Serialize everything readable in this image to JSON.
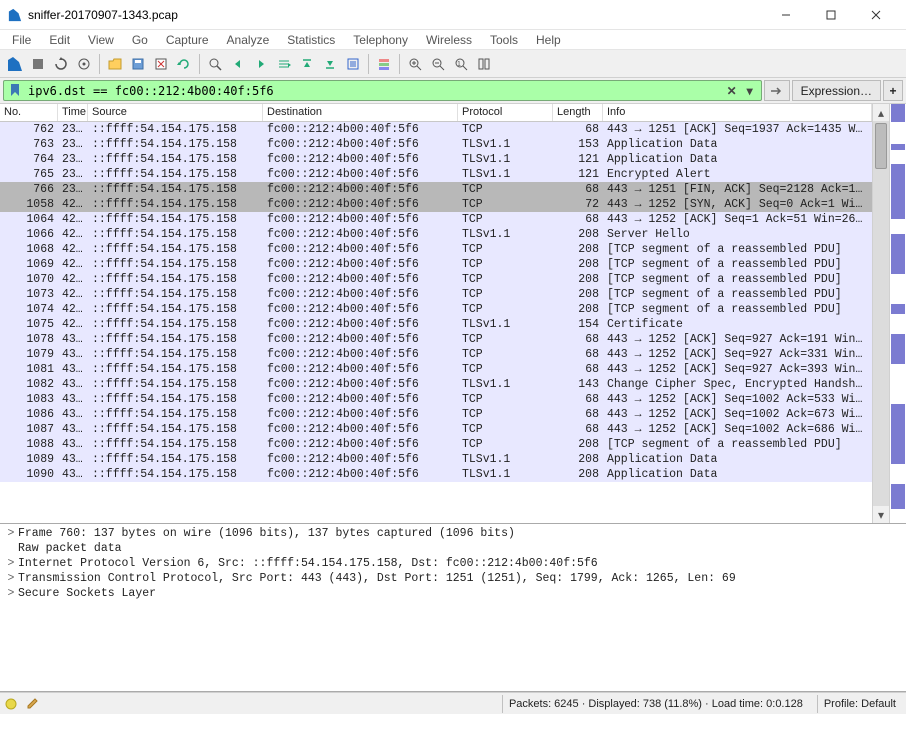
{
  "window": {
    "title": "sniffer-20170907-1343.pcap"
  },
  "menus": [
    "File",
    "Edit",
    "View",
    "Go",
    "Capture",
    "Analyze",
    "Statistics",
    "Telephony",
    "Wireless",
    "Tools",
    "Help"
  ],
  "filter": {
    "value": "ipv6.dst == fc00::212:4b00:40f:5f6",
    "expr_label": "Expression…"
  },
  "columns": {
    "no": "No.",
    "time": "Time",
    "src": "Source",
    "dst": "Destination",
    "proto": "Protocol",
    "len": "Length",
    "info": "Info"
  },
  "packets": [
    {
      "no": "762",
      "time": "23…",
      "src": "::ffff:54.154.175.158",
      "dst": "fc00::212:4b00:40f:5f6",
      "proto": "TCP",
      "len": "68",
      "info": "443 → 1251 [ACK] Seq=1937 Ack=1435 Wi…",
      "sel": false
    },
    {
      "no": "763",
      "time": "23…",
      "src": "::ffff:54.154.175.158",
      "dst": "fc00::212:4b00:40f:5f6",
      "proto": "TLSv1.1",
      "len": "153",
      "info": "Application Data",
      "sel": false
    },
    {
      "no": "764",
      "time": "23…",
      "src": "::ffff:54.154.175.158",
      "dst": "fc00::212:4b00:40f:5f6",
      "proto": "TLSv1.1",
      "len": "121",
      "info": "Application Data",
      "sel": false
    },
    {
      "no": "765",
      "time": "23…",
      "src": "::ffff:54.154.175.158",
      "dst": "fc00::212:4b00:40f:5f6",
      "proto": "TLSv1.1",
      "len": "121",
      "info": "Encrypted Alert",
      "sel": false
    },
    {
      "no": "766",
      "time": "23…",
      "src": "::ffff:54.154.175.158",
      "dst": "fc00::212:4b00:40f:5f6",
      "proto": "TCP",
      "len": "68",
      "info": "443 → 1251 [FIN, ACK] Seq=2128 Ack=14…",
      "sel": true
    },
    {
      "no": "1058",
      "time": "42…",
      "src": "::ffff:54.154.175.158",
      "dst": "fc00::212:4b00:40f:5f6",
      "proto": "TCP",
      "len": "72",
      "info": "443 → 1252 [SYN, ACK] Seq=0 Ack=1 Win…",
      "sel": true
    },
    {
      "no": "1064",
      "time": "42…",
      "src": "::ffff:54.154.175.158",
      "dst": "fc00::212:4b00:40f:5f6",
      "proto": "TCP",
      "len": "68",
      "info": "443 → 1252 [ACK] Seq=1 Ack=51 Win=268…",
      "sel": false
    },
    {
      "no": "1066",
      "time": "42…",
      "src": "::ffff:54.154.175.158",
      "dst": "fc00::212:4b00:40f:5f6",
      "proto": "TLSv1.1",
      "len": "208",
      "info": "Server Hello",
      "sel": false
    },
    {
      "no": "1068",
      "time": "42…",
      "src": "::ffff:54.154.175.158",
      "dst": "fc00::212:4b00:40f:5f6",
      "proto": "TCP",
      "len": "208",
      "info": "[TCP segment of a reassembled PDU]",
      "sel": false
    },
    {
      "no": "1069",
      "time": "42…",
      "src": "::ffff:54.154.175.158",
      "dst": "fc00::212:4b00:40f:5f6",
      "proto": "TCP",
      "len": "208",
      "info": "[TCP segment of a reassembled PDU]",
      "sel": false
    },
    {
      "no": "1070",
      "time": "42…",
      "src": "::ffff:54.154.175.158",
      "dst": "fc00::212:4b00:40f:5f6",
      "proto": "TCP",
      "len": "208",
      "info": "[TCP segment of a reassembled PDU]",
      "sel": false
    },
    {
      "no": "1073",
      "time": "42…",
      "src": "::ffff:54.154.175.158",
      "dst": "fc00::212:4b00:40f:5f6",
      "proto": "TCP",
      "len": "208",
      "info": "[TCP segment of a reassembled PDU]",
      "sel": false
    },
    {
      "no": "1074",
      "time": "42…",
      "src": "::ffff:54.154.175.158",
      "dst": "fc00::212:4b00:40f:5f6",
      "proto": "TCP",
      "len": "208",
      "info": "[TCP segment of a reassembled PDU]",
      "sel": false
    },
    {
      "no": "1075",
      "time": "42…",
      "src": "::ffff:54.154.175.158",
      "dst": "fc00::212:4b00:40f:5f6",
      "proto": "TLSv1.1",
      "len": "154",
      "info": "Certificate",
      "sel": false
    },
    {
      "no": "1078",
      "time": "43…",
      "src": "::ffff:54.154.175.158",
      "dst": "fc00::212:4b00:40f:5f6",
      "proto": "TCP",
      "len": "68",
      "info": "443 → 1252 [ACK] Seq=927 Ack=191 Win=…",
      "sel": false
    },
    {
      "no": "1079",
      "time": "43…",
      "src": "::ffff:54.154.175.158",
      "dst": "fc00::212:4b00:40f:5f6",
      "proto": "TCP",
      "len": "68",
      "info": "443 → 1252 [ACK] Seq=927 Ack=331 Win=…",
      "sel": false
    },
    {
      "no": "1081",
      "time": "43…",
      "src": "::ffff:54.154.175.158",
      "dst": "fc00::212:4b00:40f:5f6",
      "proto": "TCP",
      "len": "68",
      "info": "443 → 1252 [ACK] Seq=927 Ack=393 Win=…",
      "sel": false
    },
    {
      "no": "1082",
      "time": "43…",
      "src": "::ffff:54.154.175.158",
      "dst": "fc00::212:4b00:40f:5f6",
      "proto": "TLSv1.1",
      "len": "143",
      "info": "Change Cipher Spec, Encrypted Handsha…",
      "sel": false
    },
    {
      "no": "1083",
      "time": "43…",
      "src": "::ffff:54.154.175.158",
      "dst": "fc00::212:4b00:40f:5f6",
      "proto": "TCP",
      "len": "68",
      "info": "443 → 1252 [ACK] Seq=1002 Ack=533 Win…",
      "sel": false
    },
    {
      "no": "1086",
      "time": "43…",
      "src": "::ffff:54.154.175.158",
      "dst": "fc00::212:4b00:40f:5f6",
      "proto": "TCP",
      "len": "68",
      "info": "443 → 1252 [ACK] Seq=1002 Ack=673 Win…",
      "sel": false
    },
    {
      "no": "1087",
      "time": "43…",
      "src": "::ffff:54.154.175.158",
      "dst": "fc00::212:4b00:40f:5f6",
      "proto": "TCP",
      "len": "68",
      "info": "443 → 1252 [ACK] Seq=1002 Ack=686 Win…",
      "sel": false
    },
    {
      "no": "1088",
      "time": "43…",
      "src": "::ffff:54.154.175.158",
      "dst": "fc00::212:4b00:40f:5f6",
      "proto": "TCP",
      "len": "208",
      "info": "[TCP segment of a reassembled PDU]",
      "sel": false
    },
    {
      "no": "1089",
      "time": "43…",
      "src": "::ffff:54.154.175.158",
      "dst": "fc00::212:4b00:40f:5f6",
      "proto": "TLSv1.1",
      "len": "208",
      "info": "Application Data",
      "sel": false
    },
    {
      "no": "1090",
      "time": "43…",
      "src": "::ffff:54.154.175.158",
      "dst": "fc00::212:4b00:40f:5f6",
      "proto": "TLSv1.1",
      "len": "208",
      "info": "Application Data",
      "sel": false
    }
  ],
  "details": [
    {
      "chev": ">",
      "text": "Frame 760: 137 bytes on wire (1096 bits), 137 bytes captured (1096 bits)"
    },
    {
      "chev": "",
      "text": "Raw packet data"
    },
    {
      "chev": ">",
      "text": "Internet Protocol Version 6, Src: ::ffff:54.154.175.158, Dst: fc00::212:4b00:40f:5f6"
    },
    {
      "chev": ">",
      "text": "Transmission Control Protocol, Src Port: 443 (443), Dst Port: 1251 (1251), Seq: 1799, Ack: 1265, Len: 69"
    },
    {
      "chev": ">",
      "text": "Secure Sockets Layer"
    }
  ],
  "status": {
    "mid": "Packets: 6245 · Displayed: 738 (11.8%) · Load time: 0:0.128",
    "profile": "Profile: Default"
  }
}
